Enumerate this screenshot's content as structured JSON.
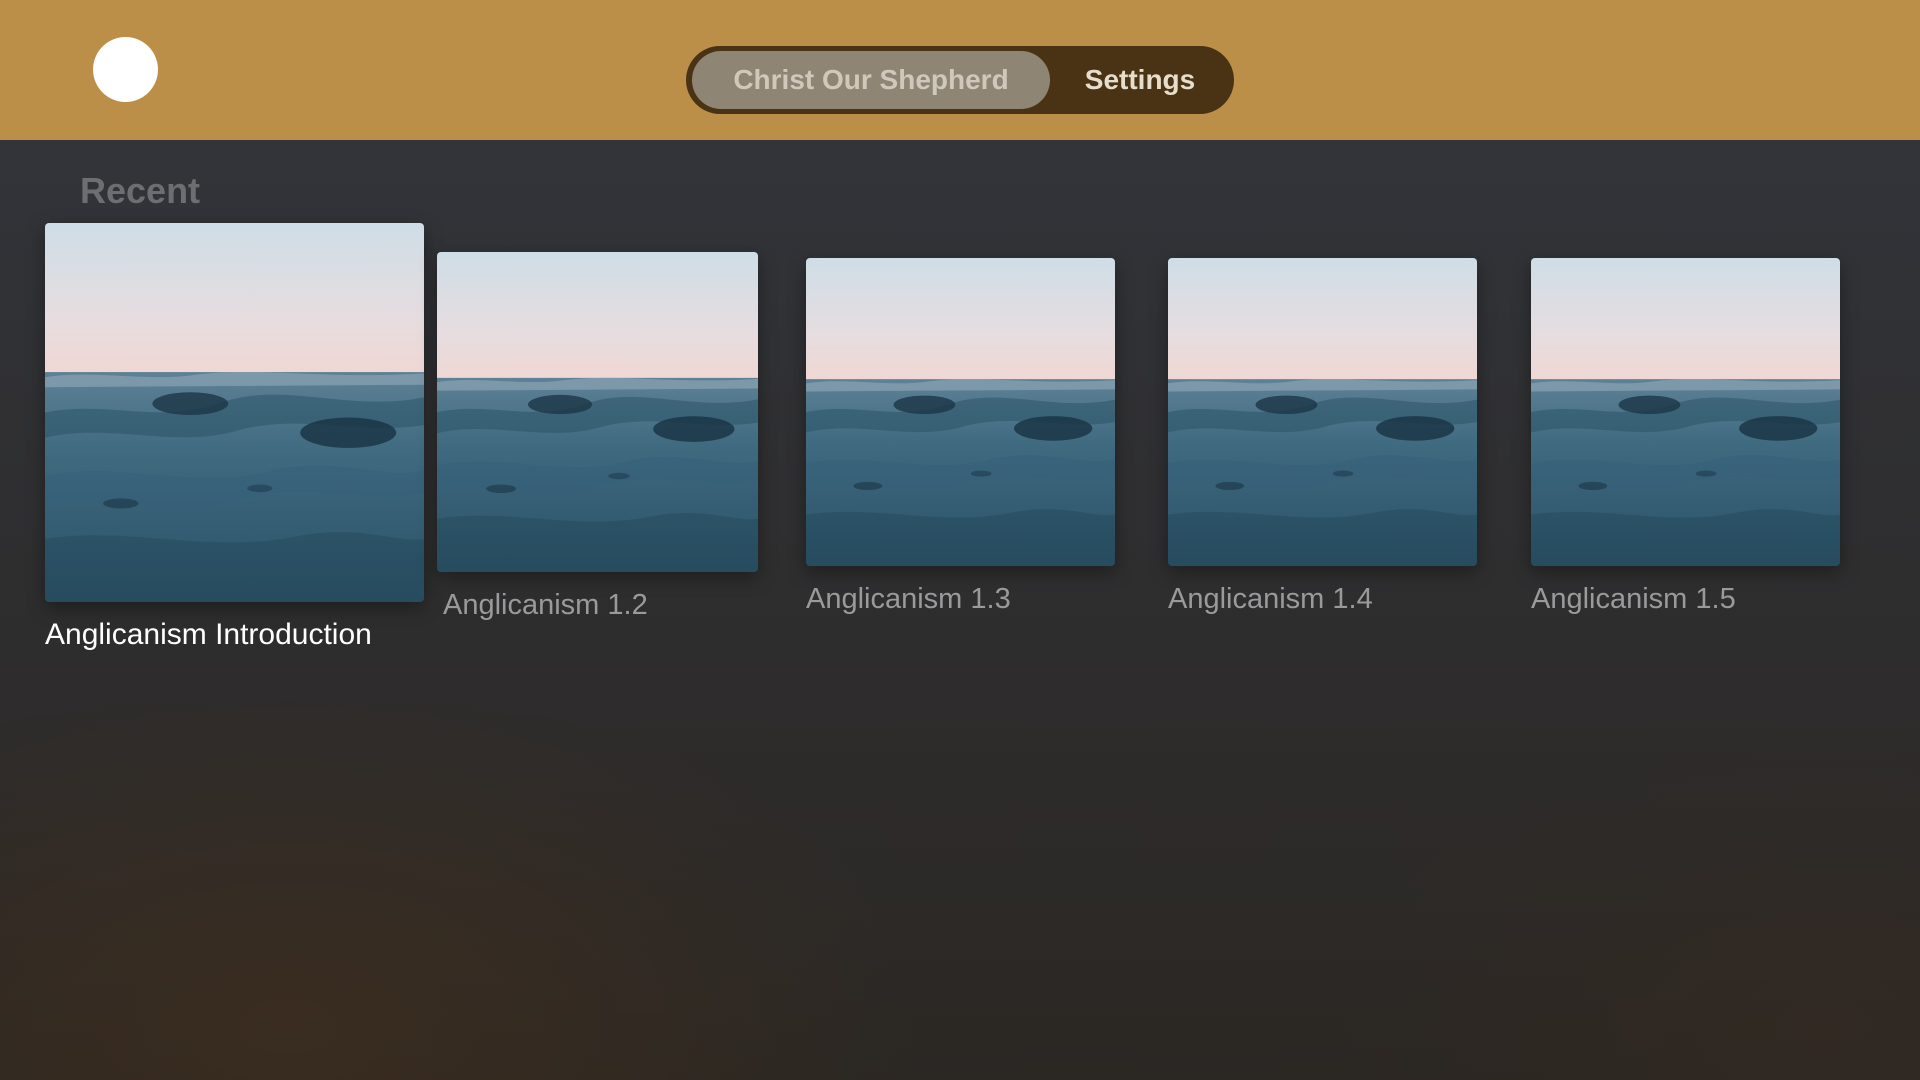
{
  "header": {
    "tabs": [
      {
        "label": "Christ Our Shepherd",
        "selected": true
      },
      {
        "label": "Settings",
        "selected": false
      }
    ]
  },
  "recent": {
    "title": "Recent",
    "items": [
      {
        "label": "Anglicanism Introduction",
        "focused": true
      },
      {
        "label": "Anglicanism 1.2",
        "focused": false
      },
      {
        "label": "Anglicanism 1.3",
        "focused": false
      },
      {
        "label": "Anglicanism 1.4",
        "focused": false
      },
      {
        "label": "Anglicanism 1.5",
        "focused": false
      }
    ]
  },
  "colors": {
    "header_background": "#bb8f47",
    "tab_bar_background": "#4a3314",
    "selected_tab_background": "#8f8574"
  }
}
